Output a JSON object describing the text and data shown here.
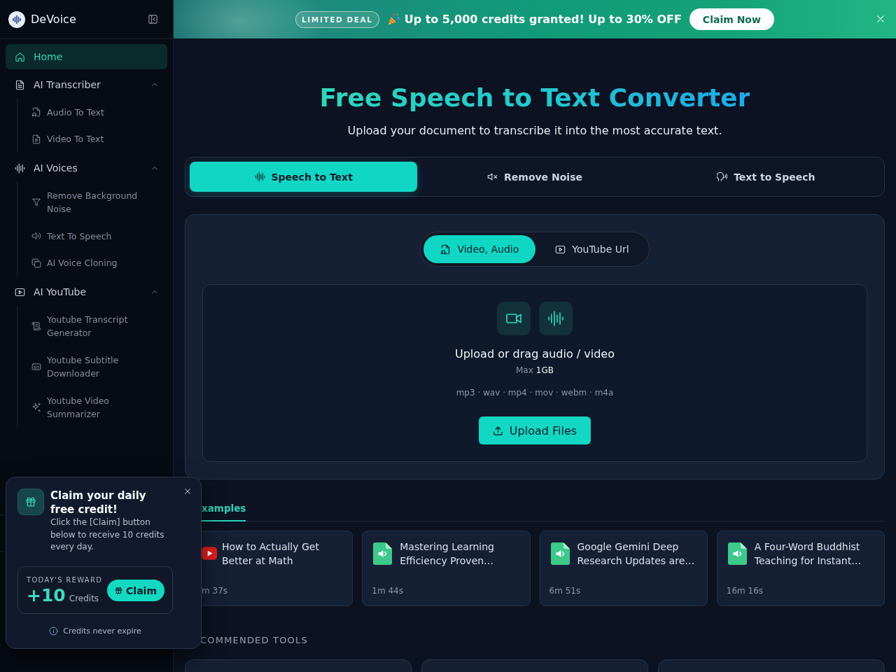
{
  "sidebar": {
    "brand": "DeVoice",
    "items": [
      {
        "kind": "link",
        "label": "Home",
        "selected": true
      },
      {
        "kind": "group",
        "label": "AI Transcriber",
        "selected": false,
        "expanded": true,
        "children": [
          {
            "label": "Audio To Text",
            "selected": false
          },
          {
            "label": "Video To Text",
            "selected": false
          }
        ]
      },
      {
        "kind": "group",
        "label": "AI Voices",
        "selected": false,
        "expanded": true,
        "children": [
          {
            "label": "Remove Background Noise",
            "selected": false
          },
          {
            "label": "Text To Speech",
            "selected": false
          },
          {
            "label": "AI Voice Cloning",
            "selected": false
          }
        ]
      },
      {
        "kind": "group",
        "label": "AI YouTube",
        "selected": false,
        "expanded": true,
        "children": [
          {
            "label": "Youtube Transcript Generator",
            "selected": false
          },
          {
            "label": "Youtube Subtitle Downloader",
            "selected": false
          },
          {
            "label": "Youtube Video Summarizer",
            "selected": false
          }
        ]
      }
    ]
  },
  "banner": {
    "badge": "LIMITED DEAL",
    "message": "Up to 5,000 credits granted! Up to 30% OFF",
    "button": "Claim Now"
  },
  "hero": {
    "title": "Free Speech to Text Converter",
    "subtitle": "Upload your document to transcribe it into the most accurate text."
  },
  "mode_tabs": [
    {
      "label": "Speech to Text",
      "selected": true
    },
    {
      "label": "Remove Noise",
      "selected": false
    },
    {
      "label": "Text to Speech",
      "selected": false
    }
  ],
  "upload": {
    "source_tabs": [
      {
        "label": "Video, Audio",
        "selected": true
      },
      {
        "label": "YouTube Url",
        "selected": false
      }
    ],
    "prompt": "Upload or drag audio / video",
    "max_label": "Max",
    "max_value": "1GB",
    "formats": "mp3 · wav · mp4 · mov · webm · m4a",
    "button": "Upload Files"
  },
  "examples": {
    "tabs": [
      {
        "label": "xamples",
        "selected": true
      }
    ],
    "cards": [
      {
        "kind": "youtube",
        "title": "How to Actually Get Better at Math",
        "duration": "m 37s"
      },
      {
        "kind": "audio",
        "title": "Mastering Learning Efficiency Proven…",
        "duration": "1m 44s"
      },
      {
        "kind": "audio",
        "title": "Google Gemini Deep Research Updates are…",
        "duration": "6m 51s"
      },
      {
        "kind": "audio",
        "title": "A Four-Word Buddhist Teaching for Instant…",
        "duration": "16m 16s"
      }
    ]
  },
  "recommended": {
    "heading": "COMMENDED TOOLS"
  },
  "popup": {
    "title": "Claim your daily free credit!",
    "body": "Click the [Claim] button below to receive 10 credits every day.",
    "reward_label": "TODAY'S REWARD",
    "reward_amount": "+10",
    "reward_unit": "Credits",
    "button": "Claim",
    "note": "Credits never expire"
  }
}
